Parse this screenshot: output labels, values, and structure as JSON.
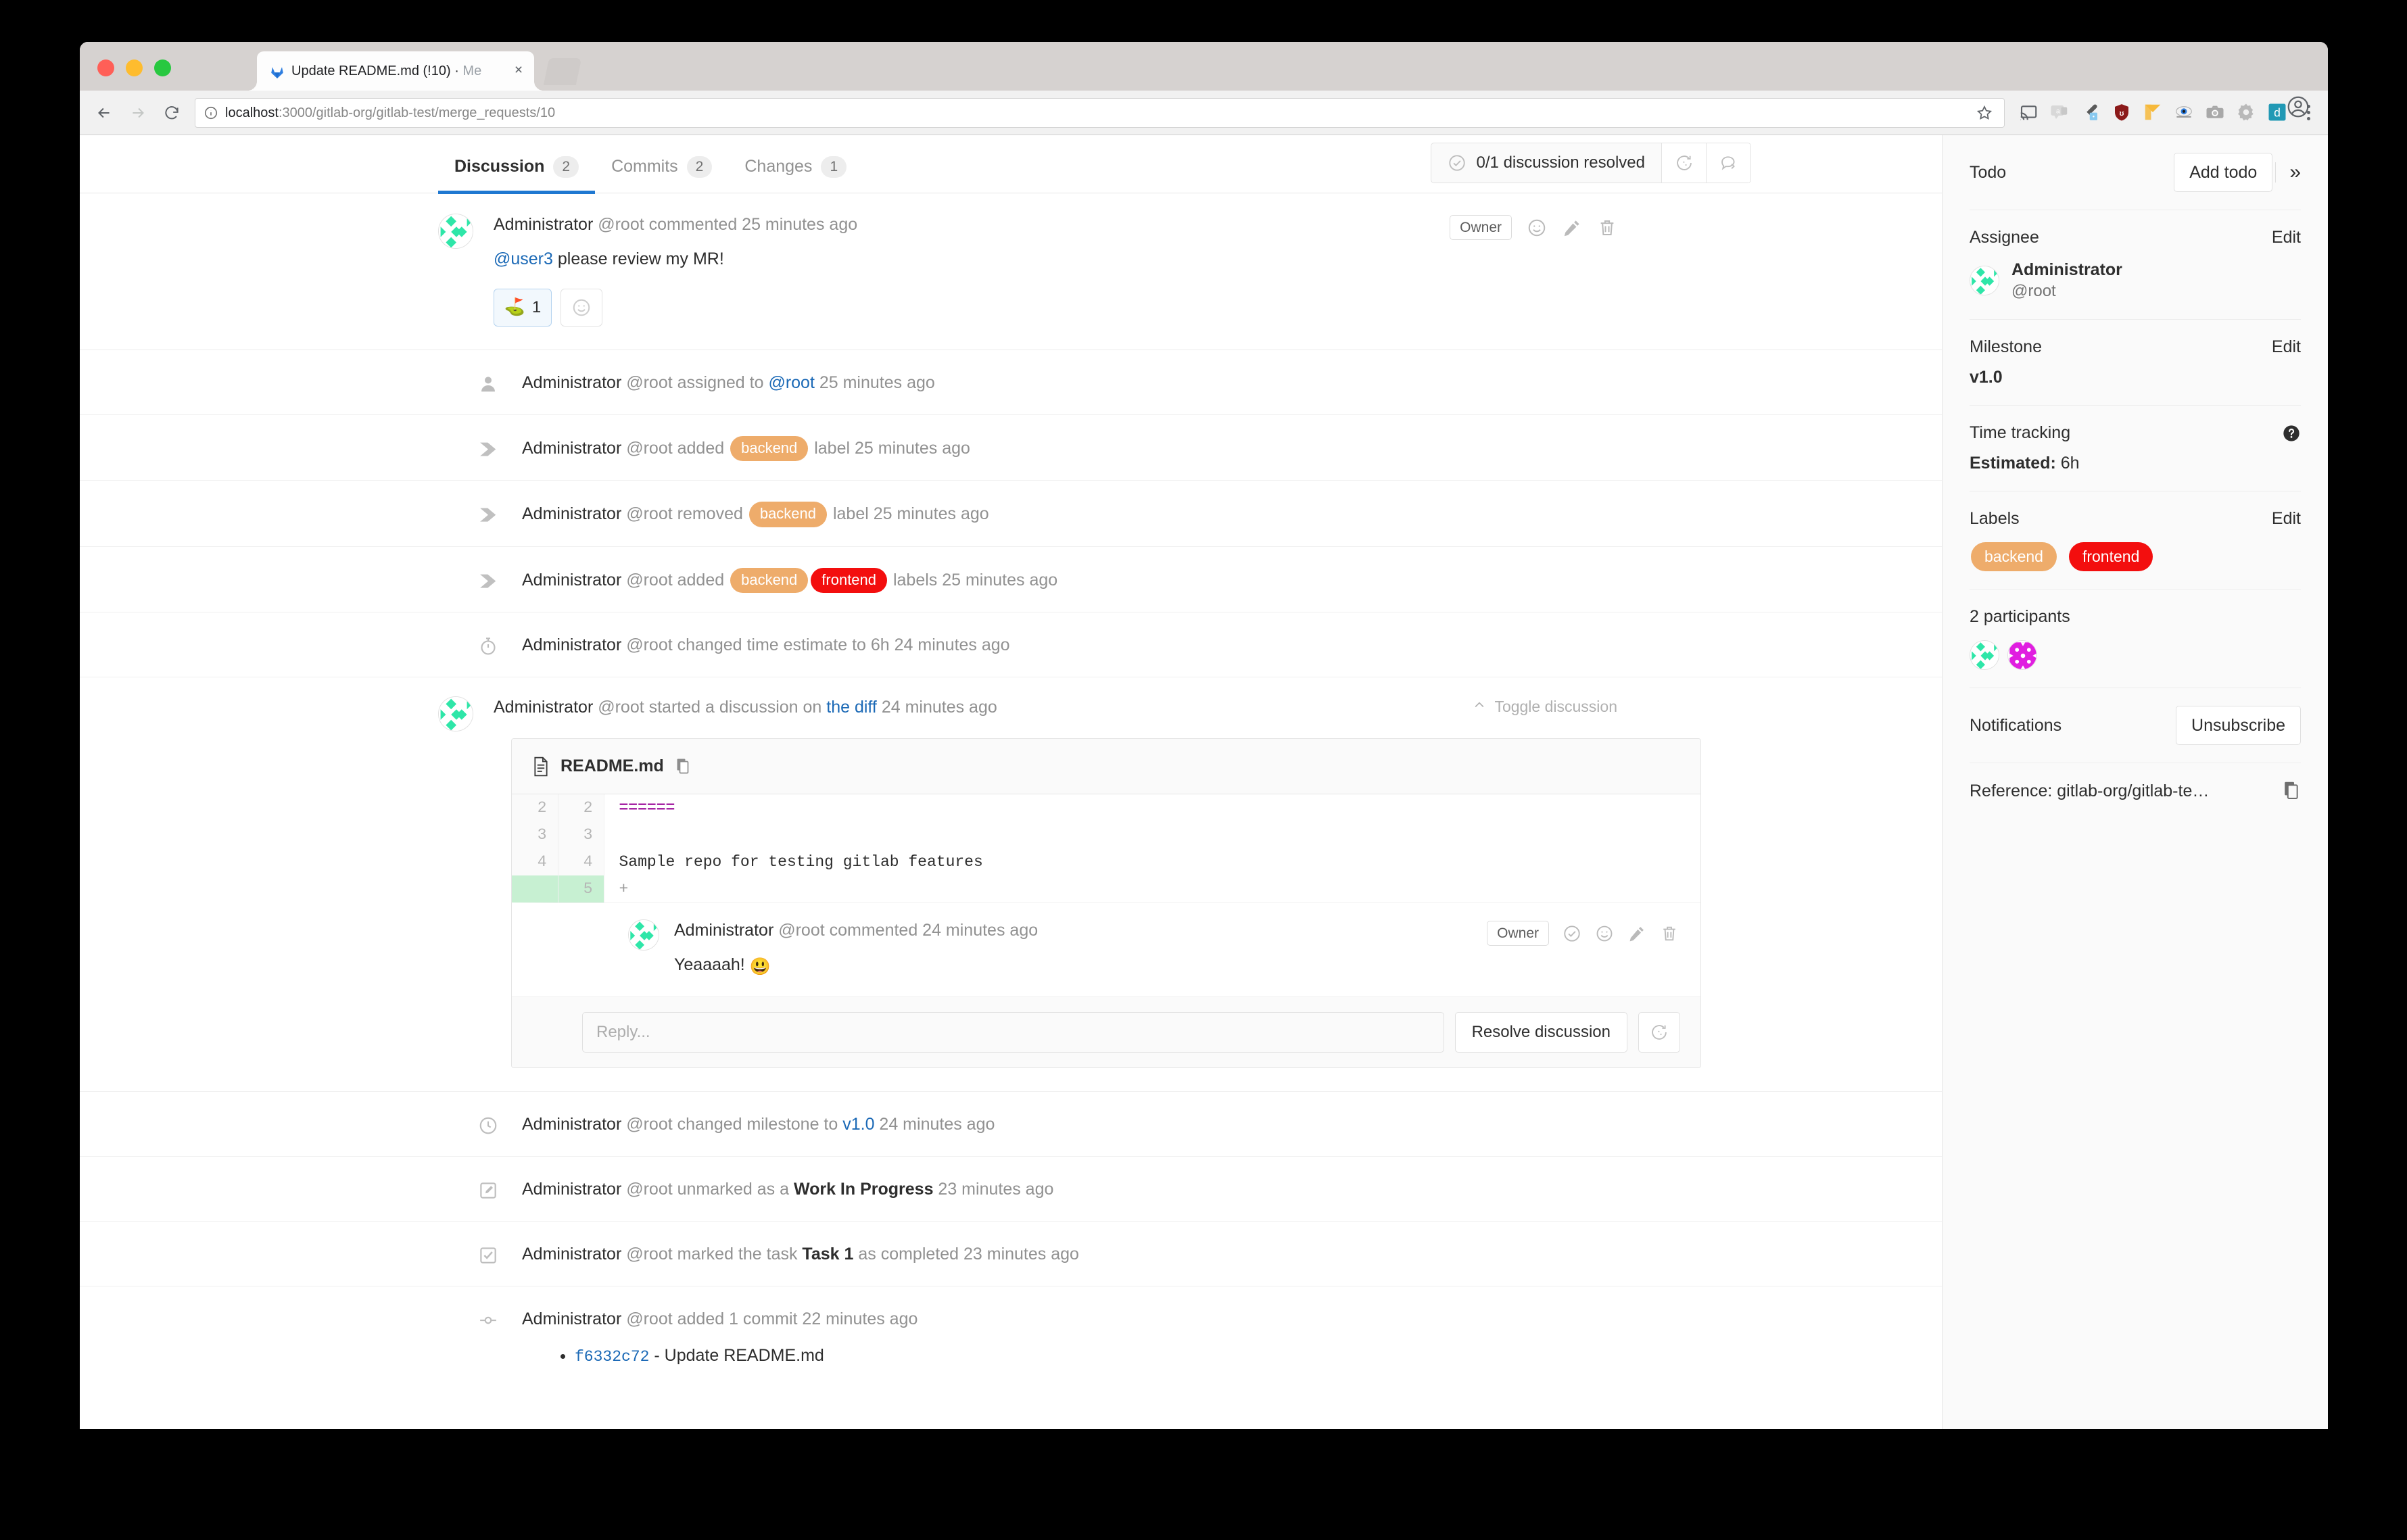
{
  "browser": {
    "tab_title_main": "Update README.md (!10) · Me",
    "tab_title_bold": "Update README.md (!10) ·",
    "tab_title_dim": " Me",
    "url_host": "localhost",
    "url_rest": ":3000/gitlab-org/gitlab-test/merge_requests/10"
  },
  "mr": {
    "tabs": [
      {
        "label": "Discussion",
        "count": "2",
        "active": true
      },
      {
        "label": "Commits",
        "count": "2",
        "active": false
      },
      {
        "label": "Changes",
        "count": "1",
        "active": false
      }
    ],
    "resolved_status": "0/1 discussion resolved"
  },
  "first_comment": {
    "author": "Administrator",
    "meta": " @root commented 25 minutes ago",
    "mention": "@user3",
    "text": " please review my MR!",
    "owner_badge": "Owner",
    "award_emoji": "⛳",
    "award_count": "1"
  },
  "system_notes": [
    {
      "icon": "user-icon",
      "author": "Administrator",
      "pre": " @root assigned to ",
      "link": "@root",
      "post": " 25 minutes ago"
    },
    {
      "icon": "tag-icon",
      "author": "Administrator",
      "pre": " @root added ",
      "label": "backend",
      "label_color": "#eeac6b",
      "post": " label 25 minutes ago"
    },
    {
      "icon": "tag-icon",
      "author": "Administrator",
      "pre": " @root removed ",
      "label": "backend",
      "label_color": "#eeac6b",
      "post": " label 25 minutes ago"
    },
    {
      "icon": "tag-icon",
      "author": "Administrator",
      "pre": " @root added ",
      "label": "backend",
      "label_color": "#eeac6b",
      "label2": "frontend",
      "label2_color": "#f30e0e",
      "post": " labels 25 minutes ago"
    },
    {
      "icon": "timer-icon",
      "author": "Administrator",
      "pre": " @root changed time estimate to 6h 24 minutes ago"
    }
  ],
  "diff_discussion": {
    "author": "Administrator",
    "pre": " @root started a discussion on ",
    "link": "the diff",
    "post": " 24 minutes ago",
    "toggle_label": "Toggle discussion",
    "file_name": "README.md",
    "lines": [
      {
        "old": "2",
        "new": "2",
        "code": "======",
        "kind": "header"
      },
      {
        "old": "3",
        "new": "3",
        "code": "",
        "kind": "normal"
      },
      {
        "old": "4",
        "new": "4",
        "code": "Sample repo for testing gitlab features",
        "kind": "normal"
      },
      {
        "old": "",
        "new": "5",
        "code": "+",
        "kind": "added"
      }
    ],
    "inline_comment": {
      "author": "Administrator",
      "meta": " @root commented 24 minutes ago",
      "text": "Yeaaaah! ",
      "emoji": "😃",
      "owner_badge": "Owner"
    },
    "reply_placeholder": "Reply...",
    "resolve_label": "Resolve discussion"
  },
  "system_notes_2": [
    {
      "icon": "clock-icon",
      "author": "Administrator",
      "pre": " @root changed milestone to ",
      "link": "v1.0",
      "post": " 24 minutes ago"
    },
    {
      "icon": "pencil-square-icon",
      "author": "Administrator",
      "pre": " @root unmarked as a ",
      "bold": "Work In Progress",
      "post": " 23 minutes ago"
    },
    {
      "icon": "task-done-icon",
      "author": "Administrator",
      "pre": " @root marked the task ",
      "bold": "Task 1",
      "post": " as completed 23 minutes ago"
    }
  ],
  "commit_note": {
    "icon": "commit-icon",
    "author": "Administrator",
    "pre": " @root added 1 commit 22 minutes ago",
    "commits": [
      {
        "sha": "f6332c72",
        "message": " - Update README.md"
      }
    ]
  },
  "sidebar": {
    "todo_label": "Todo",
    "add_todo_label": "Add todo",
    "collapse_icon": "»",
    "assignee_label": "Assignee",
    "assignee_edit": "Edit",
    "assignee_name": "Administrator",
    "assignee_user": "@root",
    "milestone_label": "Milestone",
    "milestone_edit": "Edit",
    "milestone_value": "v1.0",
    "time_tracking_label": "Time tracking",
    "time_estimated_label": "Estimated:",
    "time_estimated_value": " 6h",
    "labels_label": "Labels",
    "labels_edit": "Edit",
    "labels": [
      {
        "name": "backend",
        "color": "#eeac6b"
      },
      {
        "name": "frontend",
        "color": "#f30e0e"
      }
    ],
    "participants_label": "2 participants",
    "notifications_label": "Notifications",
    "unsubscribe_label": "Unsubscribe",
    "reference_text": "Reference: gitlab-org/gitlab-te…"
  }
}
